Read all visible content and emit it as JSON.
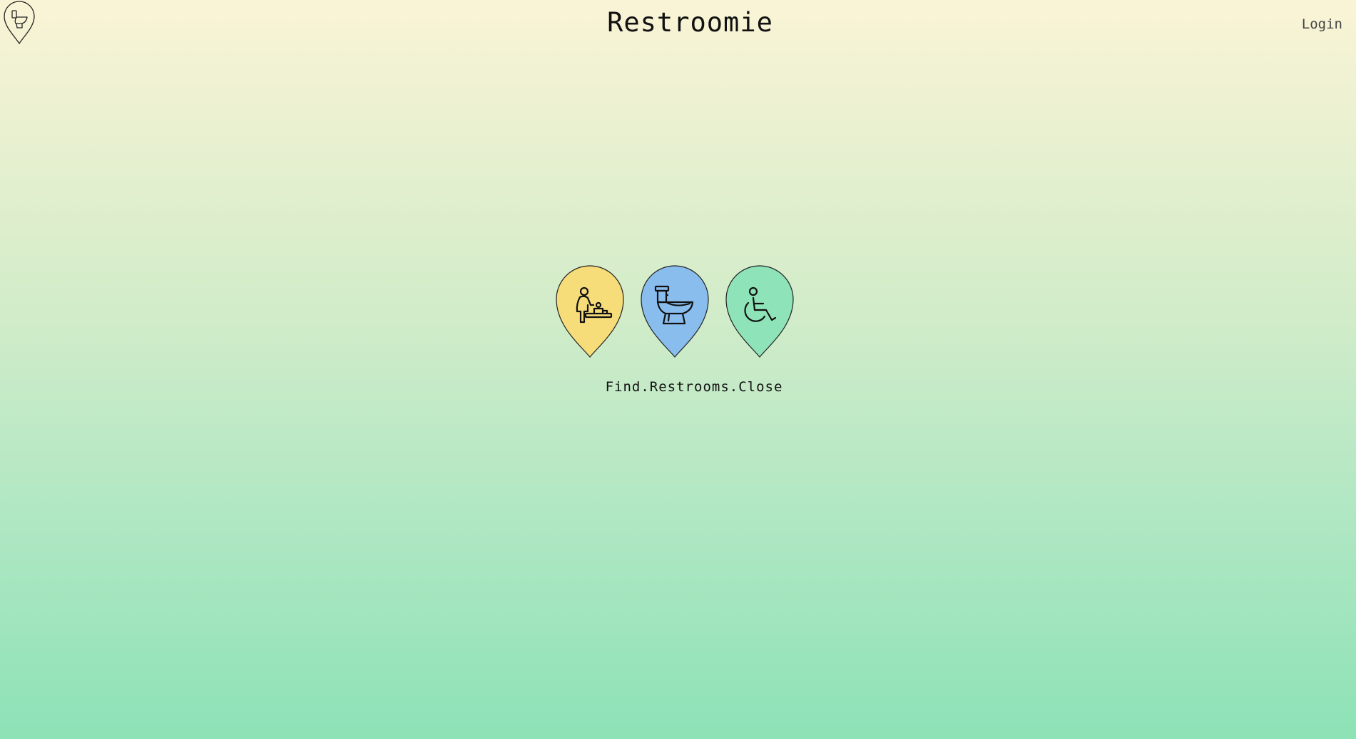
{
  "header": {
    "logo_icon": "toilet-pin-icon",
    "title": "Restroomie",
    "login_label": "Login"
  },
  "pins": [
    {
      "icon": "baby-changing-icon",
      "color": "#f7dc7a"
    },
    {
      "icon": "toilet-icon",
      "color": "#89bdee"
    },
    {
      "icon": "wheelchair-icon",
      "color": "#8ee3b8"
    }
  ],
  "tagline": "Find.Restrooms.Close"
}
